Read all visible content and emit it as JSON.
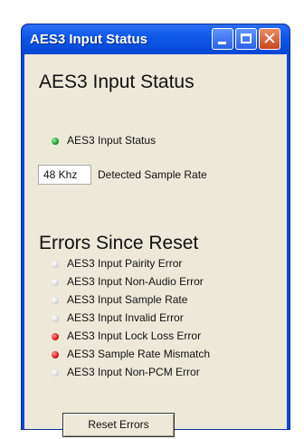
{
  "window": {
    "title": "AES3 Input Status"
  },
  "status_section": {
    "heading": "AES3 Input Status",
    "indicator": {
      "label": "AES3 Input Status",
      "state": "green"
    },
    "sample_rate": {
      "value": "48 Khz",
      "label": "Detected Sample Rate"
    }
  },
  "errors_section": {
    "heading": "Errors Since Reset",
    "items": [
      {
        "label": "AES3 Input Pairity Error",
        "state": "off"
      },
      {
        "label": "AES3 Input Non-Audio Error",
        "state": "off"
      },
      {
        "label": "AES3 Input Sample Rate",
        "state": "off"
      },
      {
        "label": "AES3 Input Invalid Error",
        "state": "off"
      },
      {
        "label": "AES3 Input Lock Loss Error",
        "state": "red"
      },
      {
        "label": "AES3 Sample Rate Mismatch",
        "state": "red"
      },
      {
        "label": "AES3 Input Non-PCM Error",
        "state": "off"
      }
    ]
  },
  "reset_button": {
    "label": "Reset Errors"
  },
  "colors": {
    "titlebar": "#0c57e8",
    "client_bg": "#ece9d8",
    "led_green": "#1f9a2a",
    "led_red": "#e01414",
    "led_off": "#d9d9d9"
  },
  "icons": [
    "minimize-icon",
    "maximize-icon",
    "close-icon",
    "status-led-icon"
  ]
}
